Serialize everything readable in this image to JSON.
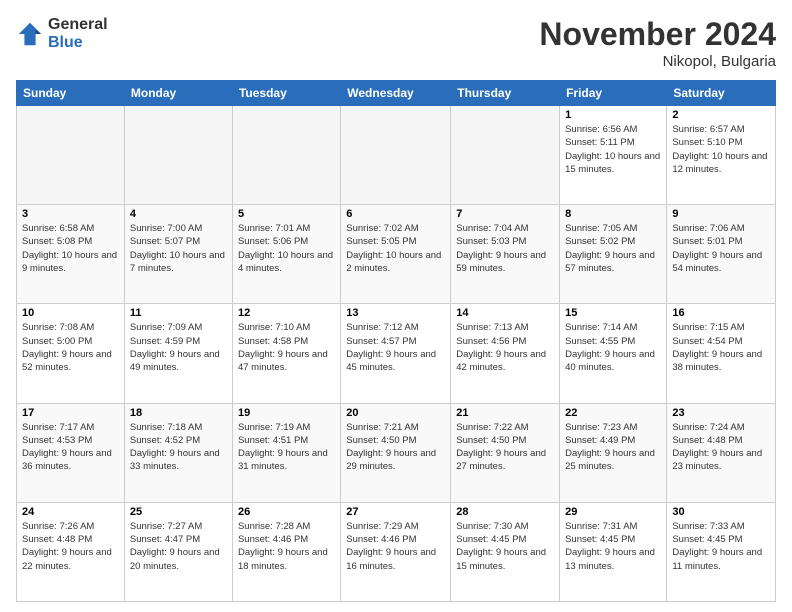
{
  "header": {
    "logo_general": "General",
    "logo_blue": "Blue",
    "month_title": "November 2024",
    "location": "Nikopol, Bulgaria"
  },
  "columns": [
    "Sunday",
    "Monday",
    "Tuesday",
    "Wednesday",
    "Thursday",
    "Friday",
    "Saturday"
  ],
  "weeks": [
    [
      {
        "day": "",
        "info": ""
      },
      {
        "day": "",
        "info": ""
      },
      {
        "day": "",
        "info": ""
      },
      {
        "day": "",
        "info": ""
      },
      {
        "day": "",
        "info": ""
      },
      {
        "day": "1",
        "info": "Sunrise: 6:56 AM\nSunset: 5:11 PM\nDaylight: 10 hours and 15 minutes."
      },
      {
        "day": "2",
        "info": "Sunrise: 6:57 AM\nSunset: 5:10 PM\nDaylight: 10 hours and 12 minutes."
      }
    ],
    [
      {
        "day": "3",
        "info": "Sunrise: 6:58 AM\nSunset: 5:08 PM\nDaylight: 10 hours and 9 minutes."
      },
      {
        "day": "4",
        "info": "Sunrise: 7:00 AM\nSunset: 5:07 PM\nDaylight: 10 hours and 7 minutes."
      },
      {
        "day": "5",
        "info": "Sunrise: 7:01 AM\nSunset: 5:06 PM\nDaylight: 10 hours and 4 minutes."
      },
      {
        "day": "6",
        "info": "Sunrise: 7:02 AM\nSunset: 5:05 PM\nDaylight: 10 hours and 2 minutes."
      },
      {
        "day": "7",
        "info": "Sunrise: 7:04 AM\nSunset: 5:03 PM\nDaylight: 9 hours and 59 minutes."
      },
      {
        "day": "8",
        "info": "Sunrise: 7:05 AM\nSunset: 5:02 PM\nDaylight: 9 hours and 57 minutes."
      },
      {
        "day": "9",
        "info": "Sunrise: 7:06 AM\nSunset: 5:01 PM\nDaylight: 9 hours and 54 minutes."
      }
    ],
    [
      {
        "day": "10",
        "info": "Sunrise: 7:08 AM\nSunset: 5:00 PM\nDaylight: 9 hours and 52 minutes."
      },
      {
        "day": "11",
        "info": "Sunrise: 7:09 AM\nSunset: 4:59 PM\nDaylight: 9 hours and 49 minutes."
      },
      {
        "day": "12",
        "info": "Sunrise: 7:10 AM\nSunset: 4:58 PM\nDaylight: 9 hours and 47 minutes."
      },
      {
        "day": "13",
        "info": "Sunrise: 7:12 AM\nSunset: 4:57 PM\nDaylight: 9 hours and 45 minutes."
      },
      {
        "day": "14",
        "info": "Sunrise: 7:13 AM\nSunset: 4:56 PM\nDaylight: 9 hours and 42 minutes."
      },
      {
        "day": "15",
        "info": "Sunrise: 7:14 AM\nSunset: 4:55 PM\nDaylight: 9 hours and 40 minutes."
      },
      {
        "day": "16",
        "info": "Sunrise: 7:15 AM\nSunset: 4:54 PM\nDaylight: 9 hours and 38 minutes."
      }
    ],
    [
      {
        "day": "17",
        "info": "Sunrise: 7:17 AM\nSunset: 4:53 PM\nDaylight: 9 hours and 36 minutes."
      },
      {
        "day": "18",
        "info": "Sunrise: 7:18 AM\nSunset: 4:52 PM\nDaylight: 9 hours and 33 minutes."
      },
      {
        "day": "19",
        "info": "Sunrise: 7:19 AM\nSunset: 4:51 PM\nDaylight: 9 hours and 31 minutes."
      },
      {
        "day": "20",
        "info": "Sunrise: 7:21 AM\nSunset: 4:50 PM\nDaylight: 9 hours and 29 minutes."
      },
      {
        "day": "21",
        "info": "Sunrise: 7:22 AM\nSunset: 4:50 PM\nDaylight: 9 hours and 27 minutes."
      },
      {
        "day": "22",
        "info": "Sunrise: 7:23 AM\nSunset: 4:49 PM\nDaylight: 9 hours and 25 minutes."
      },
      {
        "day": "23",
        "info": "Sunrise: 7:24 AM\nSunset: 4:48 PM\nDaylight: 9 hours and 23 minutes."
      }
    ],
    [
      {
        "day": "24",
        "info": "Sunrise: 7:26 AM\nSunset: 4:48 PM\nDaylight: 9 hours and 22 minutes."
      },
      {
        "day": "25",
        "info": "Sunrise: 7:27 AM\nSunset: 4:47 PM\nDaylight: 9 hours and 20 minutes."
      },
      {
        "day": "26",
        "info": "Sunrise: 7:28 AM\nSunset: 4:46 PM\nDaylight: 9 hours and 18 minutes."
      },
      {
        "day": "27",
        "info": "Sunrise: 7:29 AM\nSunset: 4:46 PM\nDaylight: 9 hours and 16 minutes."
      },
      {
        "day": "28",
        "info": "Sunrise: 7:30 AM\nSunset: 4:45 PM\nDaylight: 9 hours and 15 minutes."
      },
      {
        "day": "29",
        "info": "Sunrise: 7:31 AM\nSunset: 4:45 PM\nDaylight: 9 hours and 13 minutes."
      },
      {
        "day": "30",
        "info": "Sunrise: 7:33 AM\nSunset: 4:45 PM\nDaylight: 9 hours and 11 minutes."
      }
    ]
  ]
}
